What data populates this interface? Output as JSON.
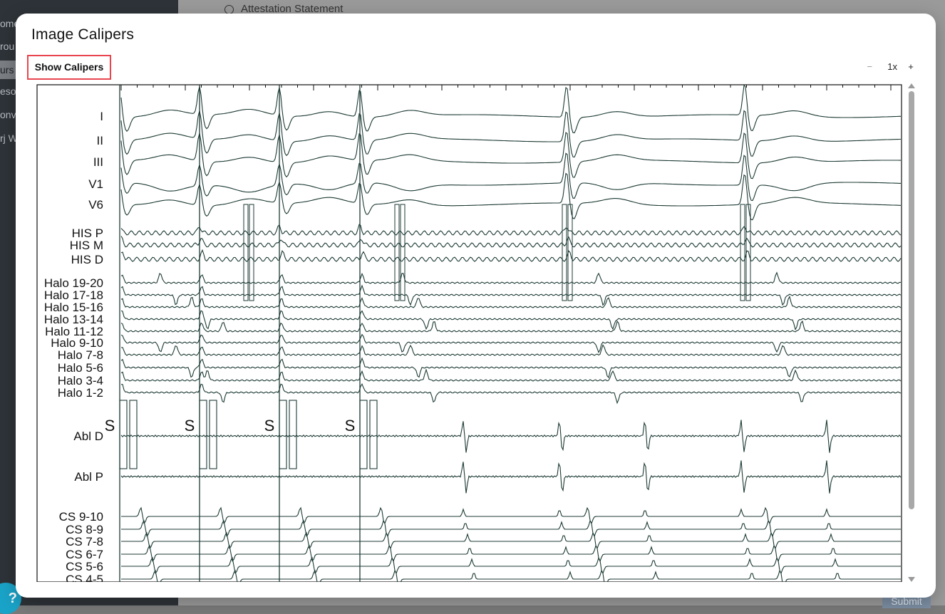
{
  "background": {
    "sidebar_items": [
      "ome",
      "rou",
      "urs",
      "esou",
      "onv",
      "rj W"
    ],
    "active_index": 2,
    "attestation_label": "Attestation Statement",
    "submit_label": "Submit",
    "help_glyph": "?"
  },
  "modal": {
    "title": "Image Calipers",
    "show_calipers_label": "Show Calipers",
    "zoom": {
      "minus": "−",
      "level": "1x",
      "plus": "+"
    }
  },
  "ecg": {
    "surface_leads": [
      "I",
      "II",
      "III",
      "V1",
      "V6"
    ],
    "his_leads": [
      "HIS P",
      "HIS M",
      "HIS D"
    ],
    "halo_leads": [
      "Halo 19-20",
      "Halo 17-18",
      "Halo 15-16",
      "Halo 13-14",
      "Halo 11-12",
      "Halo 9-10",
      "Halo 7-8",
      "Halo 5-6",
      "Halo 3-4",
      "Halo 1-2"
    ],
    "abl_leads": [
      "Abl D",
      "Abl P"
    ],
    "cs_leads": [
      "CS 9-10",
      "CS 8-9",
      "CS 7-8",
      "CS 6-7",
      "CS 5-6",
      "CS 4-5"
    ],
    "stim_marker": "S",
    "trace_color": "#1c3a34"
  },
  "icons": {
    "scroll_up": "triangle-up-icon",
    "scroll_down": "triangle-down-icon"
  }
}
